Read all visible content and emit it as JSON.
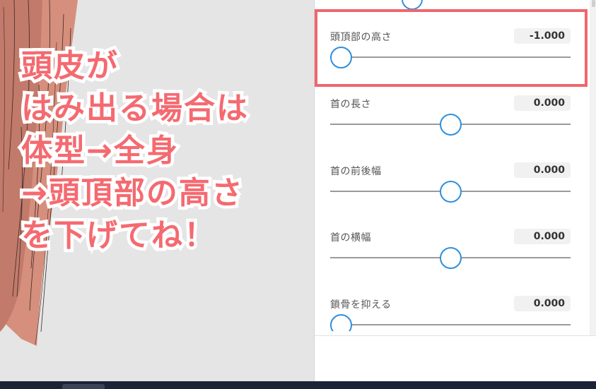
{
  "annotation": {
    "lines": [
      "頭皮が",
      "はみ出る場合は",
      "体型→全身",
      "→頭頂部の高さ",
      "を下げてね！"
    ],
    "text_color": "#f46a70",
    "highlight_color": "#f0666c"
  },
  "sliders": [
    {
      "label": "頭頂部の高さ",
      "value": "-1.000",
      "position": 0.0
    },
    {
      "label": "首の長さ",
      "value": "0.000",
      "position": 0.5
    },
    {
      "label": "首の前後幅",
      "value": "0.000",
      "position": 0.5
    },
    {
      "label": "首の横幅",
      "value": "0.000",
      "position": 0.5
    },
    {
      "label": "鎖骨を抑える",
      "value": "0.000",
      "position": 0.0
    }
  ],
  "accent_color": "#2f8fdc"
}
